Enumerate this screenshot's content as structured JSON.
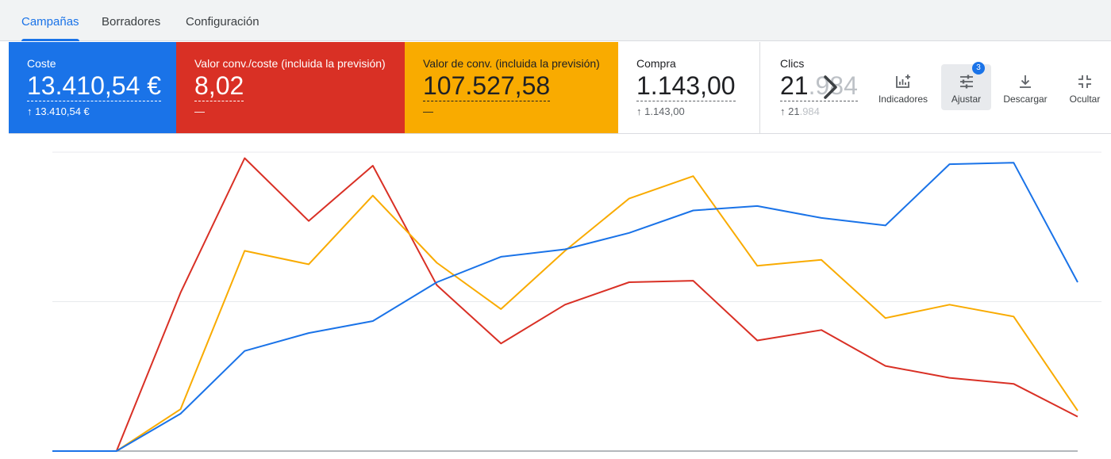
{
  "tabs": [
    {
      "label": "Campañas",
      "active": true
    },
    {
      "label": "Borradores",
      "active": false
    },
    {
      "label": "Configuración",
      "active": false
    }
  ],
  "metrics": [
    {
      "label": "Coste",
      "value": "13.410,54 €",
      "sub": "↑ 13.410,54 €",
      "color": "#1a73e8"
    },
    {
      "label": "Valor conv./coste (incluida la previsión)",
      "value": "8,02",
      "sub": "—",
      "color": "#d93025"
    },
    {
      "label": "Valor de conv. (incluida la previsión)",
      "value": "107.527,58",
      "sub": "—",
      "color": "#f9ab00"
    },
    {
      "label": "Compra",
      "value": "1.143,00",
      "sub": "↑ 1.143,00"
    },
    {
      "label": "Clics",
      "value_visible": "21",
      "value_faded": ".984",
      "sub_visible": "↑ 21",
      "sub_faded": ".984"
    }
  ],
  "toolbar": {
    "indicators_label": "Indicadores",
    "adjust_label": "Ajustar",
    "adjust_badge": "3",
    "download_label": "Descargar",
    "hide_label": "Ocultar"
  },
  "icons": {
    "next": "chevron-right-icon",
    "indicators": "add-chart-icon",
    "adjust": "tune-icon",
    "download": "download-icon",
    "hide": "collapse-icon"
  },
  "chart_data": {
    "type": "line",
    "x": [
      0,
      1,
      2,
      3,
      4,
      5,
      6,
      7,
      8,
      9,
      10,
      11,
      12,
      13,
      14,
      15,
      16
    ],
    "series": [
      {
        "color": "#1a73e8",
        "values": [
          0,
          0,
          12.5,
          33.5,
          39.5,
          43.5,
          56.5,
          65,
          67.5,
          73,
          80.5,
          82,
          78,
          75.5,
          96,
          96.5,
          56.5
        ]
      },
      {
        "color": "#d93025",
        "values": [
          0,
          0,
          53,
          98,
          77,
          95.5,
          55.5,
          36,
          49,
          56.5,
          57,
          37,
          40.5,
          28.5,
          24.5,
          22.5,
          11.5
        ]
      },
      {
        "color": "#f9ab00",
        "values": [
          0,
          0,
          14,
          67,
          62.5,
          85.5,
          63,
          47.5,
          67,
          84.5,
          92,
          62,
          64,
          44.5,
          49,
          45,
          13.5
        ]
      }
    ],
    "ylim": [
      0,
      100
    ],
    "grid": true
  }
}
